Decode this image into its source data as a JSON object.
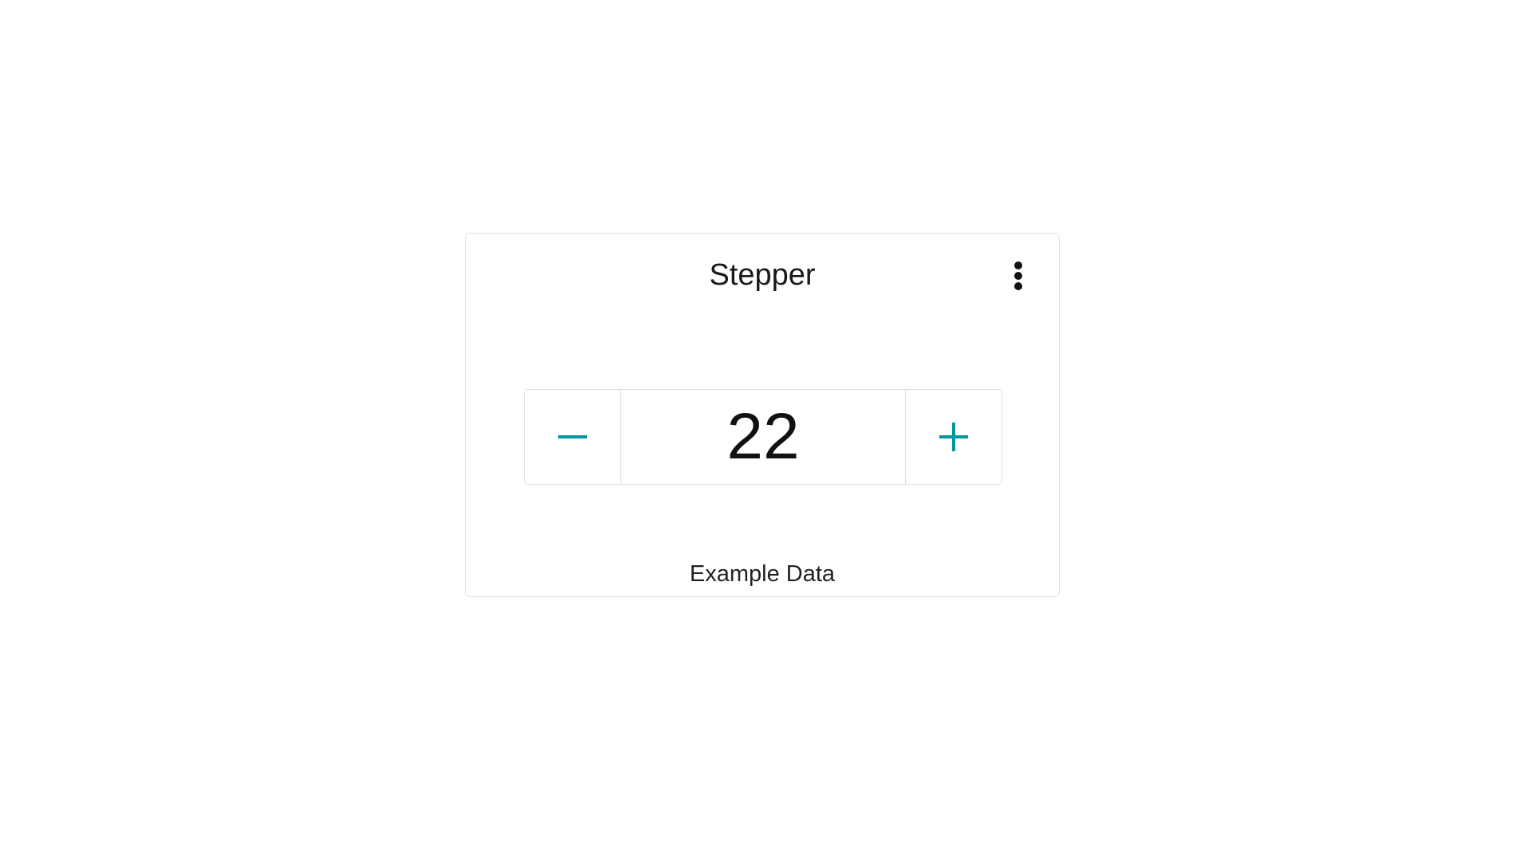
{
  "widget": {
    "title": "Stepper",
    "menu_icon": "more-vertical-icon",
    "footer_label": "Example Data"
  },
  "stepper": {
    "value": "22",
    "decrement_icon": "minus-icon",
    "increment_icon": "plus-icon"
  },
  "colors": {
    "accent": "#00979d",
    "text": "#1a1a1a",
    "border": "#dcdcdc"
  }
}
